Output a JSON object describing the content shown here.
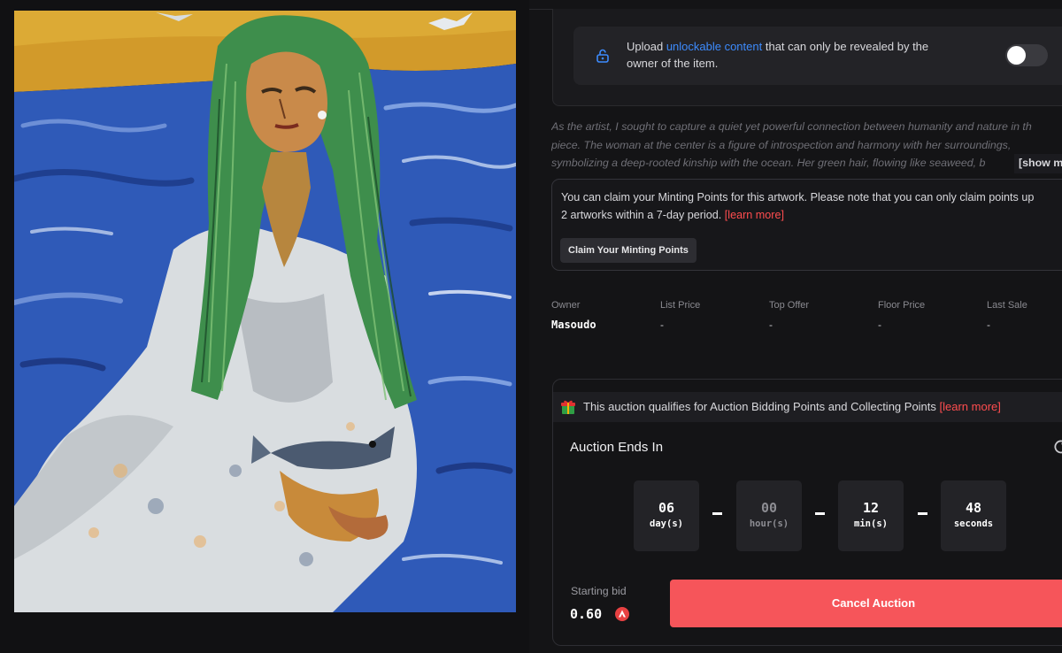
{
  "artwork": {
    "alt": "Oil painting of a woman with long green hair in a white dress holding a bowl with a fish, seated by the blue sea"
  },
  "unlockable": {
    "text_before": "Upload ",
    "link_text": "unlockable content",
    "text_after": " that can only be revealed by the owner of the item.",
    "toggle_on": false,
    "icon": "lock-icon"
  },
  "description": {
    "lines": [
      "As the artist, I sought to capture a quiet yet powerful connection between humanity and nature in th",
      "piece. The woman at the center is a figure of introspection and harmony with her surroundings,",
      "symbolizing a deep-rooted kinship with the ocean. Her green hair, flowing like seaweed, b"
    ],
    "show_more_label": "[show m"
  },
  "minting": {
    "line1": "You can claim your Minting Points for this artwork. Please note that you can only claim points up",
    "line2_text": "2 artworks within a 7-day period. ",
    "learn_more": "[learn more]",
    "claim_button": "Claim Your Minting Points"
  },
  "stats": [
    {
      "label": "Owner",
      "value": "Masoudo"
    },
    {
      "label": "List Price",
      "value": "-"
    },
    {
      "label": "Top Offer",
      "value": "-"
    },
    {
      "label": "Floor Price",
      "value": "-"
    },
    {
      "label": "Last Sale",
      "value": "-"
    }
  ],
  "auction": {
    "qualify_text": "This auction qualifies for Auction Bidding Points and Collecting Points ",
    "qualify_link": "[learn more]",
    "ends_label": "Auction Ends In",
    "countdown": [
      {
        "value": "06",
        "unit": "day(s)"
      },
      {
        "value": "00",
        "unit": "hour(s)"
      },
      {
        "value": "12",
        "unit": "min(s)"
      },
      {
        "value": "48",
        "unit": "seconds"
      }
    ],
    "starting_bid_label": "Starting bid",
    "starting_bid_value": "0.60",
    "currency_icon": "avax-icon",
    "cancel_button": "Cancel Auction"
  },
  "colors": {
    "background": "#141416",
    "card": "#232327",
    "link_blue": "#3d8bfd",
    "link_red": "#ff4d4f",
    "cancel_button": "#f6555a"
  }
}
